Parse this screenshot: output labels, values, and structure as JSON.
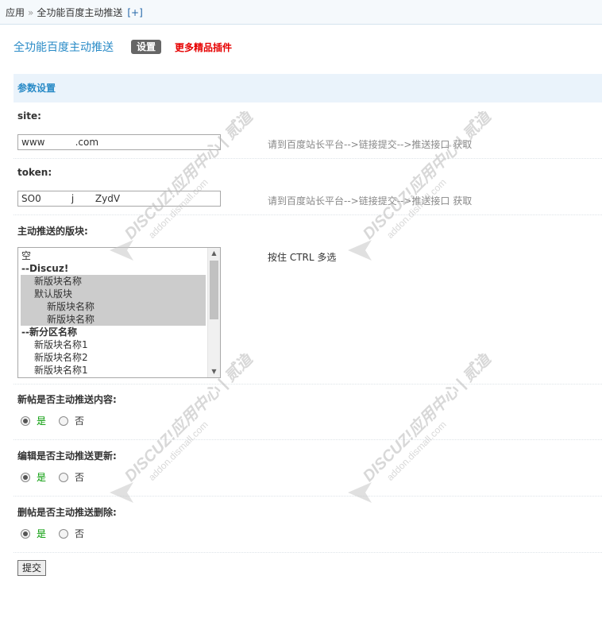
{
  "breadcrumb": {
    "root": "应用",
    "separator": "»",
    "current": "全功能百度主动推送",
    "add": "[+]"
  },
  "header": {
    "app_title": "全功能百度主动推送",
    "settings_tab": "设置",
    "more_plugins": "更多精品插件"
  },
  "section": {
    "title": "参数设置"
  },
  "site": {
    "label": "site:",
    "value": "www          .com",
    "hint": "请到百度站长平台-->链接提交-->推送接口 获取"
  },
  "token": {
    "label": "token:",
    "value": "SO0          j       ZydV",
    "hint": "请到百度站长平台-->链接提交-->推送接口 获取"
  },
  "forums": {
    "label": "主动推送的版块:",
    "hint": "按住 CTRL 多选",
    "options": [
      {
        "text": "空",
        "indent": 0,
        "group": false,
        "selected": false
      },
      {
        "text": "--Discuz!",
        "indent": 0,
        "group": true,
        "selected": false
      },
      {
        "text": "新版块名称",
        "indent": 1,
        "group": false,
        "selected": true
      },
      {
        "text": "默认版块",
        "indent": 1,
        "group": false,
        "selected": true
      },
      {
        "text": "新版块名称",
        "indent": 2,
        "group": false,
        "selected": true
      },
      {
        "text": "新版块名称",
        "indent": 2,
        "group": false,
        "selected": true
      },
      {
        "text": "--新分区名称",
        "indent": 0,
        "group": true,
        "selected": false
      },
      {
        "text": "新版块名称1",
        "indent": 1,
        "group": false,
        "selected": false
      },
      {
        "text": "新版块名称2",
        "indent": 1,
        "group": false,
        "selected": false
      },
      {
        "text": "新版块名称1",
        "indent": 1,
        "group": false,
        "selected": false
      }
    ]
  },
  "new_post": {
    "label": "新帖是否主动推送内容:",
    "yes": "是",
    "no": "否",
    "selected": "yes"
  },
  "edit_post": {
    "label": "编辑是否主动推送更新:",
    "yes": "是",
    "no": "否",
    "selected": "yes"
  },
  "delete_post": {
    "label": "删帖是否主动推送删除:",
    "yes": "是",
    "no": "否",
    "selected": "yes"
  },
  "submit": {
    "label": "提交"
  },
  "watermark": {
    "brand": "DISCUZ!",
    "center": "应用中心",
    "domain": "addon.dismall.com",
    "mark": "贰道"
  }
}
